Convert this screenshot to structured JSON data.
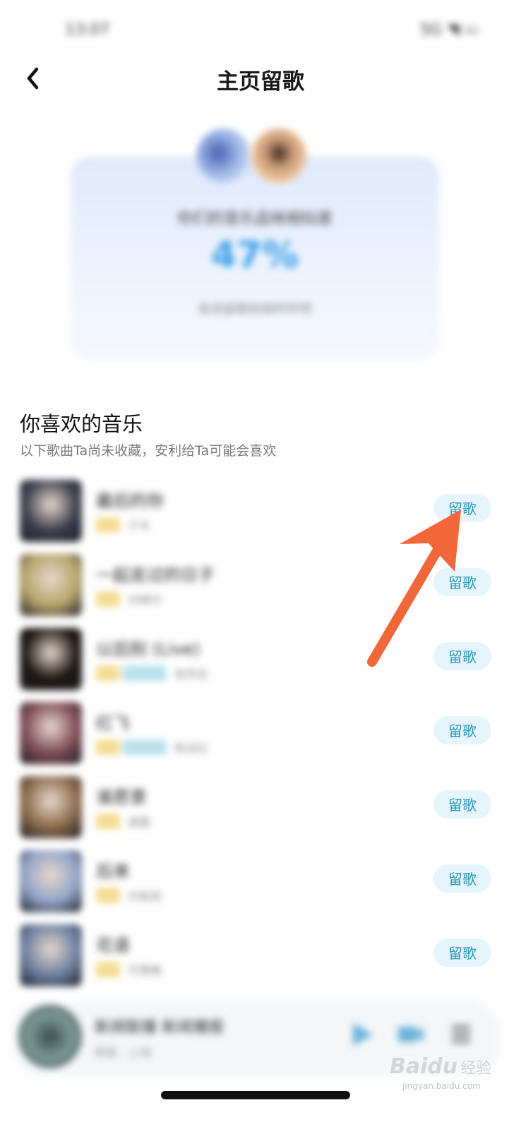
{
  "status_bar": {
    "time": "13:07",
    "indicators": "5G ◥ ▭"
  },
  "header": {
    "back_icon": "chevron-left-icon",
    "title": "主页留歌"
  },
  "match_card": {
    "label": "你们的音乐品味相似度",
    "percent": "47%",
    "sub": "发送留歌给她听听吧"
  },
  "section": {
    "title": "你喜欢的音乐",
    "subtitle": "以下歌曲Ta尚未收藏，安利给Ta可能会喜欢"
  },
  "songs": [
    {
      "name": "最后的你",
      "artist": "于冬",
      "cover_color": "#3a3d4c",
      "button": "留歌",
      "hq": false
    },
    {
      "name": "一起走过的日子",
      "artist": "刘德华",
      "cover_color": "#b7a46a",
      "button": "留歌",
      "hq": false
    },
    {
      "name": "以后别 (Live)",
      "artist": "张学友",
      "cover_color": "#1c1511",
      "button": "留歌",
      "hq": true
    },
    {
      "name": "红飞",
      "artist": "陈洁仪",
      "cover_color": "#7d4a56",
      "button": "留歌",
      "hq": true
    },
    {
      "name": "谁愿意",
      "artist": "谢霆",
      "cover_color": "#8a6a4a",
      "button": "留歌",
      "hq": false
    },
    {
      "name": "后来",
      "artist": "刘若英",
      "cover_color": "#92a4c8",
      "button": "留歌",
      "hq": false
    },
    {
      "name": "花语",
      "artist": "齐豫豫",
      "cover_color": "#6c7fa0",
      "button": "留歌",
      "hq": false
    }
  ],
  "mini_player": {
    "title": "新闻联播 新闻播报",
    "artist": "群星 - 上海",
    "play_icon": "play-icon",
    "video_icon": "video-icon",
    "playlist_icon": "playlist-icon"
  },
  "annotation": {
    "icon": "arrow-annotation-icon",
    "color": "#f2673a"
  },
  "watermark": {
    "logo": "Baidu",
    "cn": "经验",
    "url": "jingyan.baidu.com"
  }
}
